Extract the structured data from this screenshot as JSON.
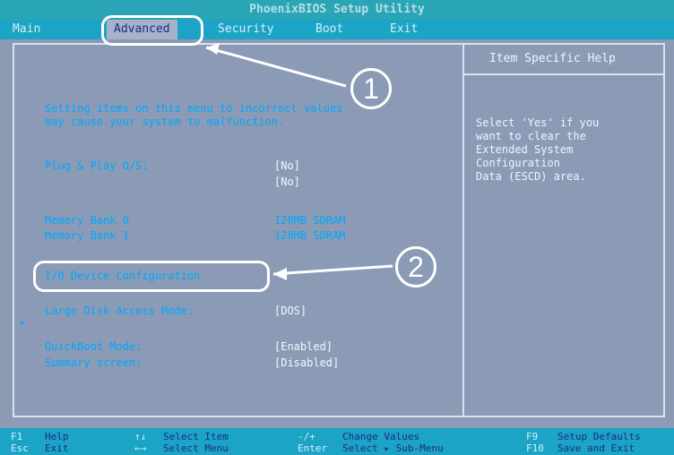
{
  "window": {
    "title": "PhoenixBIOS Setup Utility"
  },
  "menu": {
    "items": [
      {
        "label": "Main"
      },
      {
        "label": "Advanced"
      },
      {
        "label": "Security"
      },
      {
        "label": "Boot"
      },
      {
        "label": "Exit"
      }
    ]
  },
  "help": {
    "title": "Item Specific Help",
    "text": "Select 'Yes' if you\nwant to clear the\nExtended System\nConfiguration\nData (ESCD) area."
  },
  "settings": {
    "warning": "Setting items on this menu to incorrect values\nmay cause your system to malfunction.",
    "plug_play_label": "Plug & Play O/S:",
    "plug_play_value": "[No]",
    "reset_value": "[No]",
    "memory_bank_0_label": "Memory Bank 0",
    "memory_bank_0_value": "128MB SDRAM",
    "memory_bank_1_label": "Memory Bank 1",
    "memory_bank_1_value": "128MB SDRAM",
    "io_label": "I/O Device Configuration",
    "large_disk_label": "Large Disk Access Mode:",
    "large_disk_value": "[DOS]",
    "quickboot_label": "QuickBoot Mode:",
    "quickboot_value": "[Enabled]",
    "summary_label": "Summary screen:",
    "summary_value": "[Disabled]"
  },
  "callouts": {
    "one": "1",
    "two": "2"
  },
  "footer": {
    "items": [
      {
        "key": "F1",
        "label": "Help"
      },
      {
        "key": "↑↓",
        "label": "Select Item"
      },
      {
        "key": "-/+",
        "label": "Change Values"
      },
      {
        "key": "F9",
        "label": "Setup Defaults"
      },
      {
        "key": "Esc",
        "label": "Exit"
      },
      {
        "key": "←→",
        "label": "Select Menu"
      },
      {
        "key": "Enter",
        "label": "Select ▸ Sub-Menu"
      },
      {
        "key": "F10",
        "label": "Save and Exit"
      }
    ]
  },
  "colors": {
    "accent": "#1ba4c6",
    "text_blue": "#00a7ff",
    "text_white": "#f5f7ff"
  }
}
